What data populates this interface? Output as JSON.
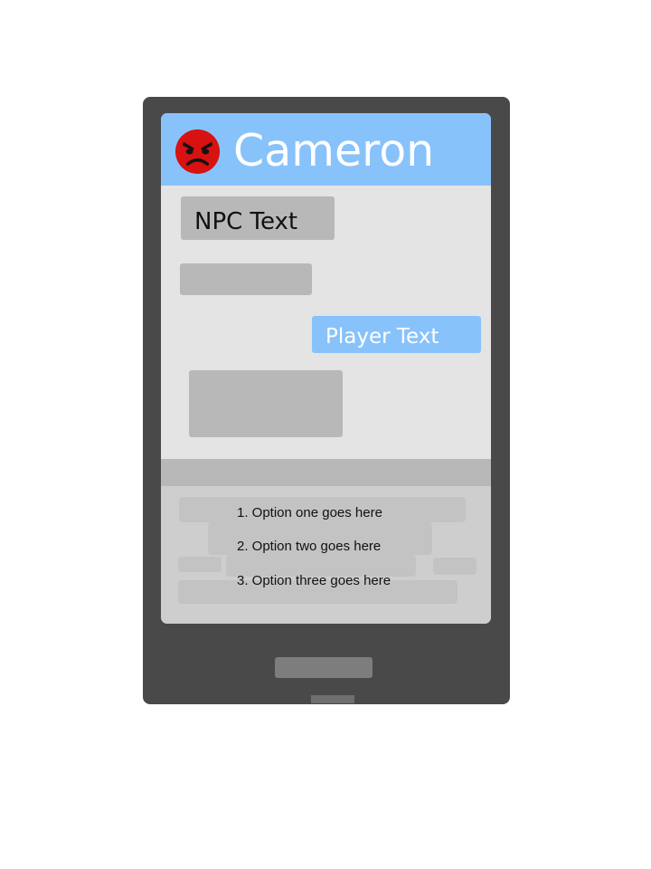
{
  "contact": {
    "name": "Cameron",
    "avatar_icon": "angry-face-icon"
  },
  "messages": {
    "npc_label": "NPC Text",
    "player_label": "Player Text"
  },
  "options": [
    {
      "label": "1. Option one goes here"
    },
    {
      "label": "2. Option two goes here"
    },
    {
      "label": "3. Option three goes here"
    }
  ],
  "colors": {
    "accent": "#88c2fb",
    "phone_body": "#494949",
    "screen_bg": "#e4e4e4",
    "bubble_gray": "#b8b8b8",
    "options_bg": "#cecece",
    "avatar_red": "#d81111"
  }
}
